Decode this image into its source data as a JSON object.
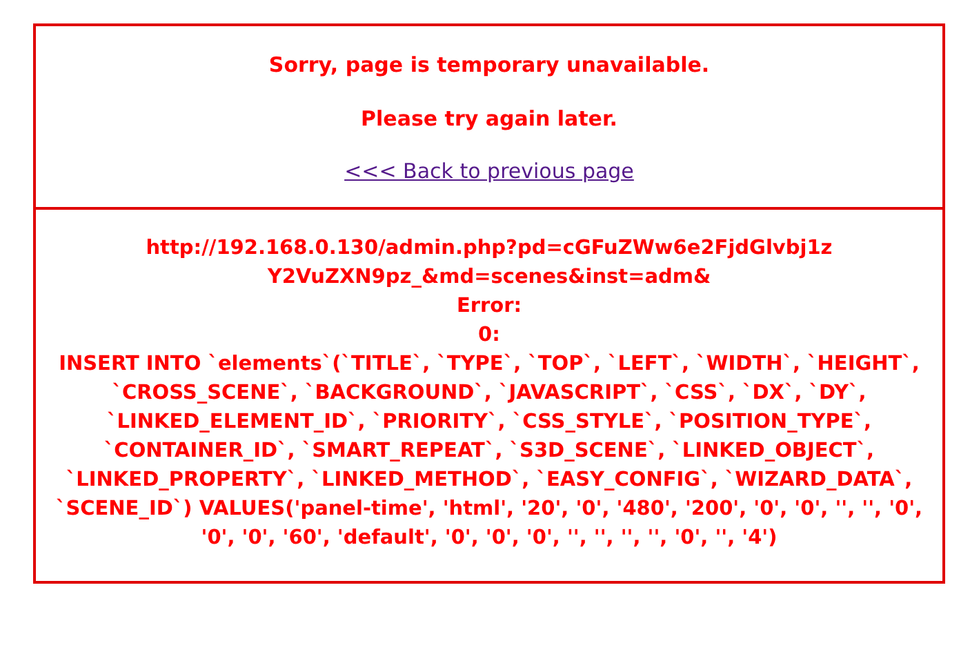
{
  "notice": {
    "title": "Sorry, page is temporary unavailable.",
    "subtitle": "Please try again later.",
    "back_link": "<<< Back to previous page"
  },
  "error": {
    "url": "http://192.168.0.130/admin.php?pd=cGFuZWw6e2FjdGlvbj1zY2VuZXN9pz_&md=scenes&inst=adm&",
    "label": "Error:",
    "code": "0:",
    "query": "INSERT INTO `elements`(`TITLE`, `TYPE`, `TOP`, `LEFT`, `WIDTH`, `HEIGHT`, `CROSS_SCENE`, `BACKGROUND`, `JAVASCRIPT`, `CSS`, `DX`, `DY`, `LINKED_ELEMENT_ID`, `PRIORITY`, `CSS_STYLE`, `POSITION_TYPE`, `CONTAINER_ID`, `SMART_REPEAT`, `S3D_SCENE`, `LINKED_OBJECT`, `LINKED_PROPERTY`, `LINKED_METHOD`, `EASY_CONFIG`, `WIZARD_DATA`, `SCENE_ID`) VALUES('panel-time', 'html', '20', '0', '480', '200', '0', '0', '', '', '0', '0', '0', '60', 'default', '0', '0', '0', '', '', '', '', '0', '', '4')"
  }
}
